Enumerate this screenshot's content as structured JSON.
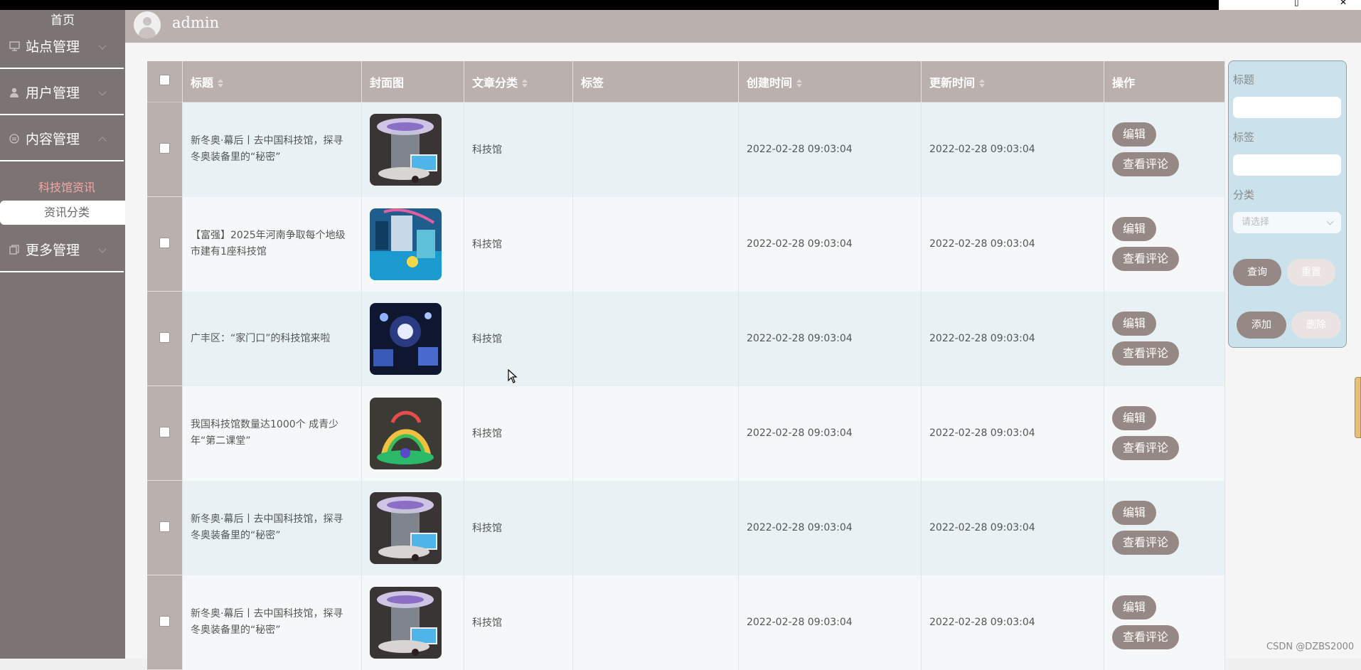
{
  "sidebar": {
    "home": "首页",
    "items": [
      {
        "label": "站点管理",
        "icon": "monitor-icon"
      },
      {
        "label": "用户管理",
        "icon": "user-icon"
      },
      {
        "label": "内容管理",
        "icon": "document-icon"
      },
      {
        "label": "更多管理",
        "icon": "copy-icon"
      }
    ],
    "sub_active": "科技馆资讯",
    "sub_selected": "资讯分类"
  },
  "header": {
    "username": "admin"
  },
  "table": {
    "columns": [
      "标题",
      "封面图",
      "文章分类",
      "标签",
      "创建时间",
      "更新时间",
      "操作"
    ],
    "rows": [
      {
        "title": "新冬奥·幕后丨去中国科技馆，探寻冬奥装备里的“秘密”",
        "category": "科技馆",
        "tag": "",
        "created": "2022-02-28 09:03:04",
        "updated": "2022-02-28 09:03:04",
        "thumb": "hall"
      },
      {
        "title": "【富强】2025年河南争取每个地级市建有1座科技馆",
        "category": "科技馆",
        "tag": "",
        "created": "2022-02-28 09:03:04",
        "updated": "2022-02-28 09:03:04",
        "thumb": "exhibit"
      },
      {
        "title": "广丰区：“家门口”的科技馆来啦",
        "category": "科技馆",
        "tag": "",
        "created": "2022-02-28 09:03:04",
        "updated": "2022-02-28 09:03:04",
        "thumb": "dark"
      },
      {
        "title": "我国科技馆数量达1000个 成青少年“第二课堂”",
        "category": "科技馆",
        "tag": "",
        "created": "2022-02-28 09:03:04",
        "updated": "2022-02-28 09:03:04",
        "thumb": "ring"
      },
      {
        "title": "新冬奥·幕后丨去中国科技馆，探寻冬奥装备里的“秘密”",
        "category": "科技馆",
        "tag": "",
        "created": "2022-02-28 09:03:04",
        "updated": "2022-02-28 09:03:04",
        "thumb": "hall"
      },
      {
        "title": "新冬奥·幕后丨去中国科技馆，探寻冬奥装备里的“秘密”",
        "category": "科技馆",
        "tag": "",
        "created": "2022-02-28 09:03:04",
        "updated": "2022-02-28 09:03:04",
        "thumb": "hall"
      }
    ],
    "edit_label": "编辑",
    "comments_label": "查看评论"
  },
  "search": {
    "title_label": "标题",
    "tag_label": "标签",
    "category_label": "分类",
    "category_placeholder": "请选择",
    "query_button": "查询",
    "reset_button": "重置",
    "add_button": "添加",
    "delete_button": "删除"
  },
  "watermark": "CSDN @DZBS2000",
  "colors": {
    "sidebar": "#7b7472",
    "header": "#bab0ad",
    "button": "#968885",
    "panel": "#cbe2ec",
    "active_sub": "#f4a6a6"
  }
}
